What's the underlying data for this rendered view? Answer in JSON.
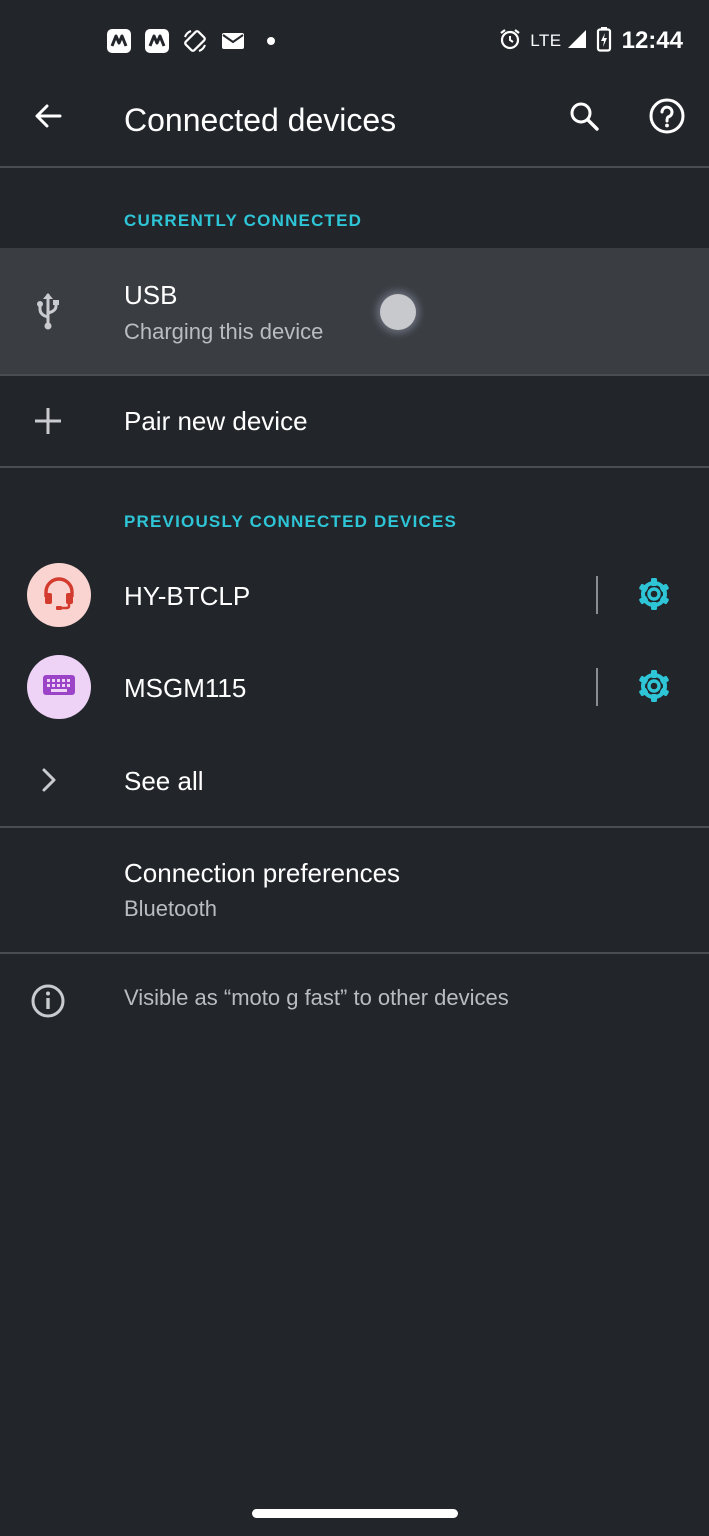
{
  "status_bar": {
    "network_label": "LTE",
    "time": "12:44",
    "notification_icons": [
      "app-n-icon",
      "app-n-icon",
      "rotate-icon",
      "mail-icon",
      "dot-icon"
    ],
    "system_icons": [
      "alarm-icon",
      "signal-icon",
      "battery-charging-icon"
    ]
  },
  "app_bar": {
    "title": "Connected devices",
    "icons": [
      "back-arrow-icon",
      "search-icon",
      "help-icon"
    ]
  },
  "currently_connected": {
    "header": "CURRENTLY CONNECTED",
    "usb": {
      "title": "USB",
      "subtitle": "Charging this device",
      "icon": "usb-icon"
    }
  },
  "pair_new": {
    "label": "Pair new device",
    "icon": "plus-icon"
  },
  "previously_connected": {
    "header": "PREVIOUSLY CONNECTED DEVICES",
    "devices": [
      {
        "name": "HY-BTCLP",
        "icon": "headset-icon",
        "avatar_bg": "#f9d4d0",
        "icon_color": "#d33b2f"
      },
      {
        "name": "MSGM115",
        "icon": "keyboard-icon",
        "avatar_bg": "#eed3f7",
        "icon_color": "#9b44c8"
      }
    ],
    "see_all": "See all"
  },
  "connection_preferences": {
    "title": "Connection preferences",
    "subtitle": "Bluetooth"
  },
  "visibility": {
    "text": "Visible as “moto g fast” to other devices",
    "icon": "info-icon"
  },
  "colors": {
    "background": "#22262b",
    "accent": "#2ec5d6",
    "highlight_row": "#3a3e43",
    "divider": "#4a4d52"
  }
}
